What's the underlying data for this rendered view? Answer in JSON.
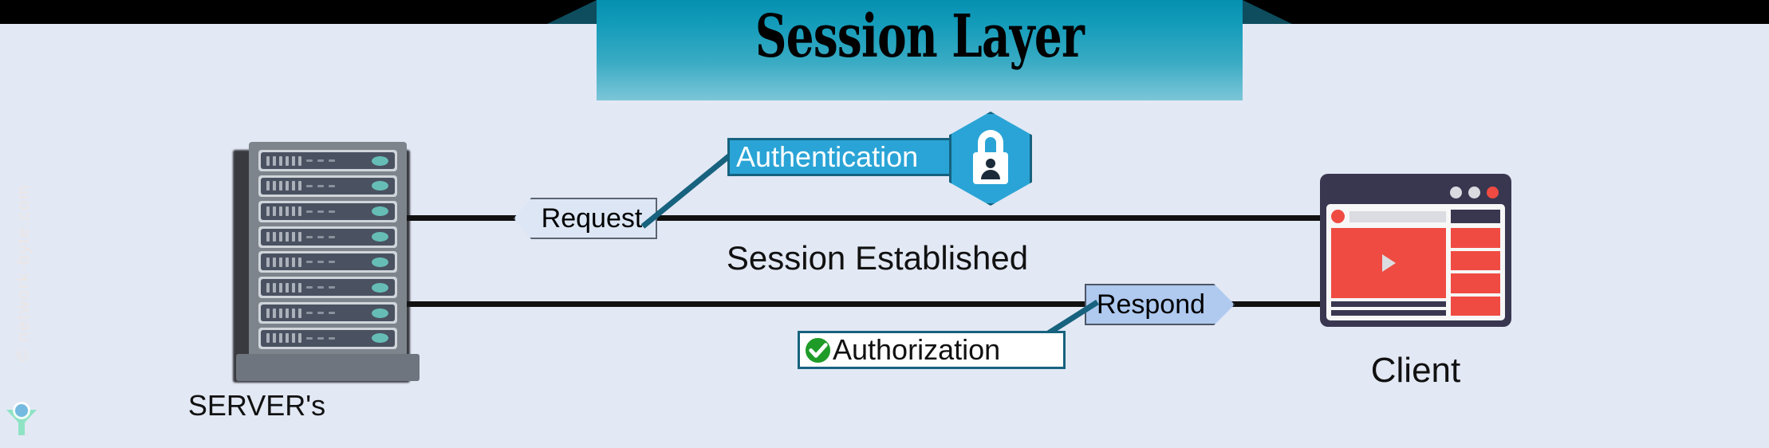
{
  "diagram": {
    "title": "Session Layer",
    "watermark": "© network-byte.com",
    "nodes": {
      "server": {
        "label": "SERVER's",
        "icon": "server-rack-icon",
        "slot_count": 8,
        "bars_per_slot": 6,
        "dashes_per_slot": 3,
        "led_color": "#66bdb6",
        "body_color": "#7e848c"
      },
      "client": {
        "label": "Client",
        "icon": "browser-window-icon",
        "window_dots": [
          "grey",
          "grey",
          "red"
        ],
        "sidebar_blocks": 4,
        "accent_color": "#ef4b42",
        "frame_color": "#393750"
      }
    },
    "flows": [
      {
        "name": "request-flow",
        "label": "Request",
        "direction": "client-to-server",
        "arrow": "left",
        "fill": "#dce6f5"
      },
      {
        "name": "respond-flow",
        "label": "Respond",
        "direction": "server-to-client",
        "arrow": "right",
        "fill": "#afc9ef"
      }
    ],
    "center_caption": "Session Established",
    "badges": [
      {
        "name": "authentication-badge",
        "label": "Authentication",
        "icon": "padlock-user-icon",
        "fill": "#2aa4d6",
        "border": "#16627f",
        "text_color": "#ffffff"
      },
      {
        "name": "authorization-badge",
        "label": "Authorization",
        "icon": "green-check-icon",
        "fill": "#ffffff",
        "border": "#17627e",
        "text_color": "#111111"
      }
    ],
    "colors": {
      "background": "#e2e8f4",
      "banner_top": "#0690b0",
      "banner_bottom": "#7cc6d8",
      "banner_tail": "#0d4d5e",
      "line": "#111111",
      "connector": "#17627e",
      "check_green": "#1f9b28"
    }
  }
}
